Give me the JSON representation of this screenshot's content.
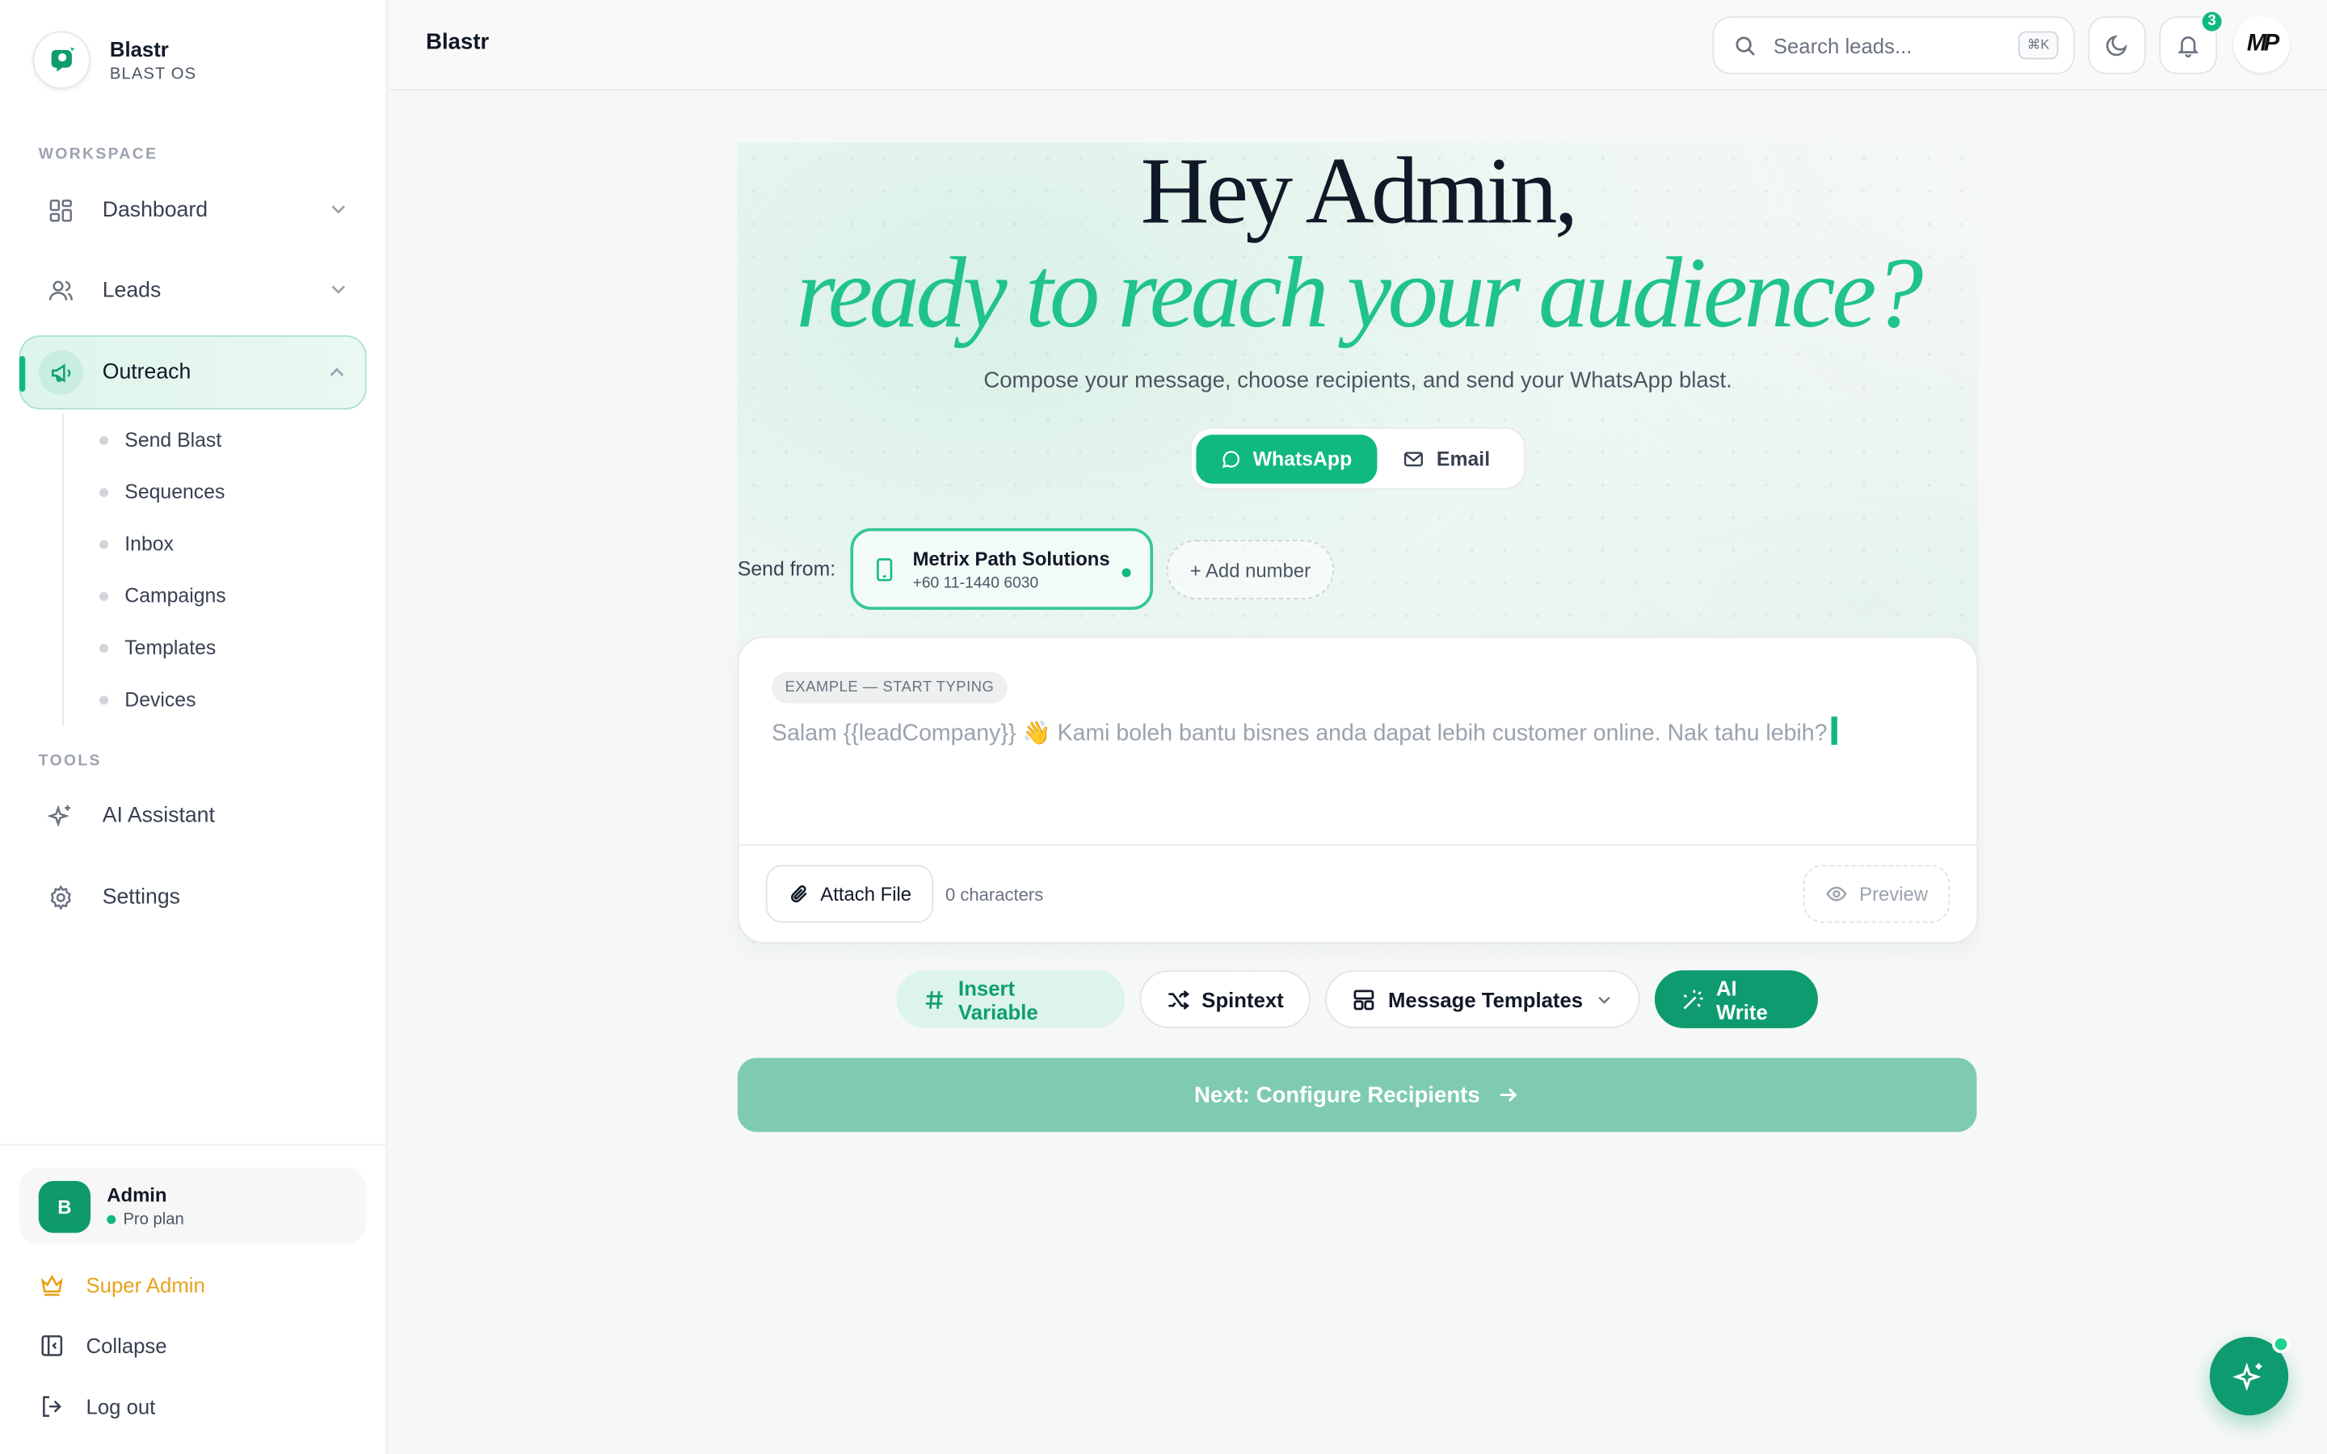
{
  "brand": {
    "name": "Blastr",
    "subtitle": "BLAST OS"
  },
  "sidebar": {
    "workspace_label": "WORKSPACE",
    "tools_label": "TOOLS",
    "items": [
      {
        "label": "Dashboard",
        "icon": "grid-icon"
      },
      {
        "label": "Leads",
        "icon": "users-icon"
      },
      {
        "label": "Outreach",
        "icon": "megaphone-icon",
        "active": true
      }
    ],
    "outreach_sub": [
      "Send Blast",
      "Sequences",
      "Inbox",
      "Campaigns",
      "Templates",
      "Devices"
    ],
    "tools": [
      {
        "label": "AI Assistant",
        "icon": "sparkles-icon"
      },
      {
        "label": "Settings",
        "icon": "gear-icon"
      }
    ],
    "user": {
      "initial": "B",
      "name": "Admin",
      "plan": "Pro plan"
    },
    "super_admin": "Super Admin",
    "collapse": "Collapse",
    "logout": "Log out"
  },
  "topbar": {
    "title": "Blastr",
    "search_placeholder": "Search leads...",
    "shortcut": "⌘K",
    "notifications": "3",
    "avatar_text": "MP"
  },
  "hero": {
    "line1": "Hey Admin,",
    "line2": "ready to reach your audience?",
    "subtitle": "Compose your message, choose recipients, and send your WhatsApp blast."
  },
  "channels": {
    "whatsapp": "WhatsApp",
    "email": "Email",
    "selected": "WhatsApp"
  },
  "send_from": {
    "label": "Send from:",
    "device_name": "Metrix Path Solutions",
    "device_number": "+60 11-1440 6030",
    "add_number": "+ Add number"
  },
  "composer": {
    "example_tag": "EXAMPLE — START TYPING",
    "placeholder_text": "Salam {{leadCompany}} 👋 Kami boleh bantu bisnes anda dapat lebih customer online. Nak tahu lebih?",
    "attach": "Attach File",
    "char_count": "0 characters",
    "preview": "Preview"
  },
  "tools": {
    "insert_variable": "Insert Variable",
    "spintext": "Spintext",
    "message_templates": "Message Templates",
    "ai_write": "AI Write"
  },
  "next_button": "Next: Configure Recipients",
  "colors": {
    "accent": "#10b981",
    "accent_dark": "#0e9b6f",
    "gold": "#e8a21a"
  }
}
